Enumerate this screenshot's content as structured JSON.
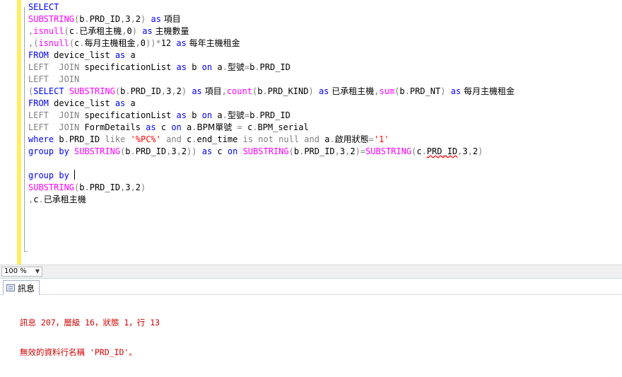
{
  "editor": {
    "lines": [
      [
        {
          "t": "SELECT",
          "c": "kw"
        }
      ],
      [
        {
          "t": "SUBSTRING",
          "c": "fn"
        },
        {
          "t": "(",
          "c": "op"
        },
        {
          "t": "b",
          "c": ""
        },
        {
          "t": ".",
          "c": "op"
        },
        {
          "t": "PRD_ID",
          "c": ""
        },
        {
          "t": ",",
          "c": "op"
        },
        {
          "t": "3",
          "c": ""
        },
        {
          "t": ",",
          "c": "op"
        },
        {
          "t": "2",
          "c": ""
        },
        {
          "t": ")",
          "c": "op"
        },
        {
          "t": " ",
          "c": ""
        },
        {
          "t": "as",
          "c": "kw"
        },
        {
          "t": " 項目",
          "c": "cjk"
        }
      ],
      [
        {
          "t": ",",
          "c": "op"
        },
        {
          "t": "isnull",
          "c": "fn"
        },
        {
          "t": "(",
          "c": "op"
        },
        {
          "t": "c",
          "c": ""
        },
        {
          "t": ".",
          "c": "op"
        },
        {
          "t": "已承租主機",
          "c": "cjk"
        },
        {
          "t": ",",
          "c": "op"
        },
        {
          "t": "0",
          "c": ""
        },
        {
          "t": ")",
          "c": "op"
        },
        {
          "t": " ",
          "c": ""
        },
        {
          "t": "as",
          "c": "kw"
        },
        {
          "t": " 主機數量",
          "c": "cjk"
        }
      ],
      [
        {
          "t": ",(",
          "c": "op"
        },
        {
          "t": "isnull",
          "c": "fn"
        },
        {
          "t": "(",
          "c": "op"
        },
        {
          "t": "c",
          "c": ""
        },
        {
          "t": ".",
          "c": "op"
        },
        {
          "t": "每月主機租金",
          "c": "cjk"
        },
        {
          "t": ",",
          "c": "op"
        },
        {
          "t": "0",
          "c": ""
        },
        {
          "t": "))*",
          "c": "op"
        },
        {
          "t": "12 ",
          "c": ""
        },
        {
          "t": "as",
          "c": "kw"
        },
        {
          "t": " 每年主機租金",
          "c": "cjk"
        }
      ],
      [
        {
          "t": "FROM",
          "c": "kw"
        },
        {
          "t": " device_list ",
          "c": ""
        },
        {
          "t": "as",
          "c": "kw"
        },
        {
          "t": " a",
          "c": ""
        }
      ],
      [
        {
          "t": "LEFT  JOIN",
          "c": "op"
        },
        {
          "t": " specificationList ",
          "c": ""
        },
        {
          "t": "as",
          "c": "kw"
        },
        {
          "t": " b ",
          "c": ""
        },
        {
          "t": "on",
          "c": "kw"
        },
        {
          "t": " a",
          "c": ""
        },
        {
          "t": ".",
          "c": "op"
        },
        {
          "t": "型號",
          "c": "cjk"
        },
        {
          "t": "=",
          "c": "op"
        },
        {
          "t": "b",
          "c": ""
        },
        {
          "t": ".",
          "c": "op"
        },
        {
          "t": "PRD_ID",
          "c": ""
        }
      ],
      [
        {
          "t": "LEFT  JOIN",
          "c": "op"
        }
      ],
      [
        {
          "t": "(",
          "c": "op"
        },
        {
          "t": "SELECT",
          "c": "kw"
        },
        {
          "t": " ",
          "c": ""
        },
        {
          "t": "SUBSTRING",
          "c": "fn"
        },
        {
          "t": "(",
          "c": "op"
        },
        {
          "t": "b",
          "c": ""
        },
        {
          "t": ".",
          "c": "op"
        },
        {
          "t": "PRD_ID",
          "c": ""
        },
        {
          "t": ",",
          "c": "op"
        },
        {
          "t": "3",
          "c": ""
        },
        {
          "t": ",",
          "c": "op"
        },
        {
          "t": "2",
          "c": ""
        },
        {
          "t": ")",
          "c": "op"
        },
        {
          "t": " ",
          "c": ""
        },
        {
          "t": "as",
          "c": "kw"
        },
        {
          "t": " 項目",
          "c": "cjk"
        },
        {
          "t": ",",
          "c": "op"
        },
        {
          "t": "count",
          "c": "fn"
        },
        {
          "t": "(",
          "c": "op"
        },
        {
          "t": "b",
          "c": ""
        },
        {
          "t": ".",
          "c": "op"
        },
        {
          "t": "PRD_KIND",
          "c": ""
        },
        {
          "t": ")",
          "c": "op"
        },
        {
          "t": " ",
          "c": ""
        },
        {
          "t": "as",
          "c": "kw"
        },
        {
          "t": " 已承租主機",
          "c": "cjk"
        },
        {
          "t": ",",
          "c": "op"
        },
        {
          "t": "sum",
          "c": "fn"
        },
        {
          "t": "(",
          "c": "op"
        },
        {
          "t": "b",
          "c": ""
        },
        {
          "t": ".",
          "c": "op"
        },
        {
          "t": "PRD_NT",
          "c": ""
        },
        {
          "t": ")",
          "c": "op"
        },
        {
          "t": " ",
          "c": ""
        },
        {
          "t": "as",
          "c": "kw"
        },
        {
          "t": " 每月主機租金",
          "c": "cjk"
        }
      ],
      [
        {
          "t": "FROM",
          "c": "kw"
        },
        {
          "t": " device_list ",
          "c": ""
        },
        {
          "t": "as",
          "c": "kw"
        },
        {
          "t": " a",
          "c": ""
        }
      ],
      [
        {
          "t": "LEFT  JOIN",
          "c": "op"
        },
        {
          "t": " specificationList ",
          "c": ""
        },
        {
          "t": "as",
          "c": "kw"
        },
        {
          "t": " b ",
          "c": ""
        },
        {
          "t": "on",
          "c": "kw"
        },
        {
          "t": " a",
          "c": ""
        },
        {
          "t": ".",
          "c": "op"
        },
        {
          "t": "型號",
          "c": "cjk"
        },
        {
          "t": "=",
          "c": "op"
        },
        {
          "t": "b",
          "c": ""
        },
        {
          "t": ".",
          "c": "op"
        },
        {
          "t": "PRD_ID",
          "c": ""
        }
      ],
      [
        {
          "t": "LEFT  JOIN",
          "c": "op"
        },
        {
          "t": " FormDetails ",
          "c": ""
        },
        {
          "t": "as",
          "c": "kw"
        },
        {
          "t": " c ",
          "c": ""
        },
        {
          "t": "on",
          "c": "kw"
        },
        {
          "t": " a",
          "c": ""
        },
        {
          "t": ".",
          "c": "op"
        },
        {
          "t": "BPM單號",
          "c": "cjk"
        },
        {
          "t": " = ",
          "c": "op"
        },
        {
          "t": "c",
          "c": ""
        },
        {
          "t": ".",
          "c": "op"
        },
        {
          "t": "BPM_serial",
          "c": ""
        }
      ],
      [
        {
          "t": "where",
          "c": "kw"
        },
        {
          "t": " b",
          "c": ""
        },
        {
          "t": ".",
          "c": "op"
        },
        {
          "t": "PRD_ID ",
          "c": ""
        },
        {
          "t": "like",
          "c": "op"
        },
        {
          "t": " ",
          "c": ""
        },
        {
          "t": "'%PC%'",
          "c": "str"
        },
        {
          "t": " ",
          "c": ""
        },
        {
          "t": "and",
          "c": "op"
        },
        {
          "t": " c",
          "c": ""
        },
        {
          "t": ".",
          "c": "op"
        },
        {
          "t": "end_time ",
          "c": ""
        },
        {
          "t": "is",
          "c": "op"
        },
        {
          "t": " ",
          "c": ""
        },
        {
          "t": "not",
          "c": "op"
        },
        {
          "t": " ",
          "c": ""
        },
        {
          "t": "null",
          "c": "op"
        },
        {
          "t": " ",
          "c": ""
        },
        {
          "t": "and",
          "c": "op"
        },
        {
          "t": " a",
          "c": ""
        },
        {
          "t": ".",
          "c": "op"
        },
        {
          "t": "啟用狀態",
          "c": "cjk"
        },
        {
          "t": "=",
          "c": "op"
        },
        {
          "t": "'1'",
          "c": "str"
        }
      ],
      [
        {
          "t": "group by",
          "c": "kw"
        },
        {
          "t": " ",
          "c": ""
        },
        {
          "t": "SUBSTRING",
          "c": "fn"
        },
        {
          "t": "(",
          "c": "op"
        },
        {
          "t": "b",
          "c": ""
        },
        {
          "t": ".",
          "c": "op"
        },
        {
          "t": "PRD_ID",
          "c": ""
        },
        {
          "t": ",",
          "c": "op"
        },
        {
          "t": "3",
          "c": ""
        },
        {
          "t": ",",
          "c": "op"
        },
        {
          "t": "2",
          "c": ""
        },
        {
          "t": "))",
          "c": "op"
        },
        {
          "t": " ",
          "c": ""
        },
        {
          "t": "as",
          "c": "kw"
        },
        {
          "t": " c ",
          "c": ""
        },
        {
          "t": "on",
          "c": "kw"
        },
        {
          "t": " ",
          "c": ""
        },
        {
          "t": "SUBSTRING",
          "c": "fn"
        },
        {
          "t": "(",
          "c": "op"
        },
        {
          "t": "b",
          "c": ""
        },
        {
          "t": ".",
          "c": "op"
        },
        {
          "t": "PRD_ID",
          "c": ""
        },
        {
          "t": ",",
          "c": "op"
        },
        {
          "t": "3",
          "c": ""
        },
        {
          "t": ",",
          "c": "op"
        },
        {
          "t": "2",
          "c": ""
        },
        {
          "t": ")=",
          "c": "op"
        },
        {
          "t": "SUBSTRING",
          "c": "fn"
        },
        {
          "t": "(",
          "c": "op"
        },
        {
          "t": "c",
          "c": ""
        },
        {
          "t": ".",
          "c": "op"
        },
        {
          "t": "PRD_ID",
          "c": "squig"
        },
        {
          "t": ",",
          "c": "op"
        },
        {
          "t": "3",
          "c": ""
        },
        {
          "t": ",",
          "c": "op"
        },
        {
          "t": "2",
          "c": ""
        },
        {
          "t": ")",
          "c": "op"
        }
      ],
      [],
      [
        {
          "t": "group by",
          "c": "kw"
        },
        {
          "t": " ",
          "c": ""
        },
        {
          "t": "",
          "c": "caret"
        }
      ],
      [
        {
          "t": "SUBSTRING",
          "c": "fn"
        },
        {
          "t": "(",
          "c": "op"
        },
        {
          "t": "b",
          "c": ""
        },
        {
          "t": ".",
          "c": "op"
        },
        {
          "t": "PRD_ID",
          "c": ""
        },
        {
          "t": ",",
          "c": "op"
        },
        {
          "t": "3",
          "c": ""
        },
        {
          "t": ",",
          "c": "op"
        },
        {
          "t": "2",
          "c": ""
        },
        {
          "t": ")",
          "c": "op"
        }
      ],
      [
        {
          "t": ",",
          "c": "op"
        },
        {
          "t": "c",
          "c": ""
        },
        {
          "t": ".",
          "c": "op"
        },
        {
          "t": "已承租主機",
          "c": "cjk"
        }
      ]
    ]
  },
  "statusbar": {
    "zoom_value": "100 %",
    "zoom_arrow": "▼"
  },
  "results": {
    "tab_label": "訊息",
    "messages": [
      "訊息 207，層級 16，狀態 1，行 13",
      "無效的資料行名稱 'PRD_ID'。"
    ]
  }
}
